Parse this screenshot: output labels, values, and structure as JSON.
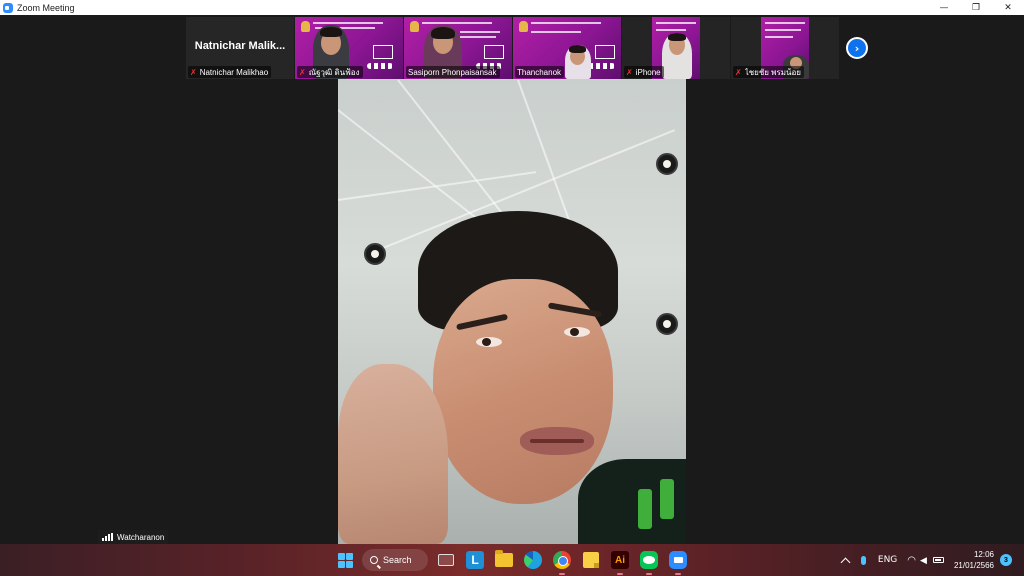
{
  "window": {
    "title": "Zoom Meeting",
    "minimize": "—",
    "restore": "❐",
    "close": "✕"
  },
  "gallery": {
    "tiles": [
      {
        "kind": "name",
        "big_name": "Natnichar  Malik...",
        "label": "Natnichar Malikhao",
        "muted": true
      },
      {
        "kind": "slide",
        "label": "ณัฐวุฒิ ดินฟ้อง",
        "muted": true
      },
      {
        "kind": "slide",
        "label": "Sasiporn Phonpaisansak",
        "muted": false
      },
      {
        "kind": "slide",
        "label": "Thanchanok",
        "muted": false
      },
      {
        "kind": "slide",
        "label": "iPhone",
        "muted": true
      },
      {
        "kind": "slide",
        "label": "ไชยชัย พรมน้อย",
        "muted": true
      }
    ],
    "mic_muted_icon": "🎤̸",
    "next_page_icon": "›"
  },
  "speaker": {
    "name": "Watcharanon"
  },
  "taskbar": {
    "search_label": "Search",
    "apps": [
      "start",
      "search",
      "task-view",
      "l-app",
      "file-explorer",
      "edge",
      "chrome",
      "sticky-notes",
      "illustrator",
      "line",
      "zoom"
    ],
    "tray": {
      "language": "ENG",
      "time": "12:06",
      "date": "21/01/2566",
      "notifications": "3"
    }
  },
  "colors": {
    "accent": "#0e72ed",
    "slide": "#a01c9e",
    "muted_icon": "#e33333"
  }
}
